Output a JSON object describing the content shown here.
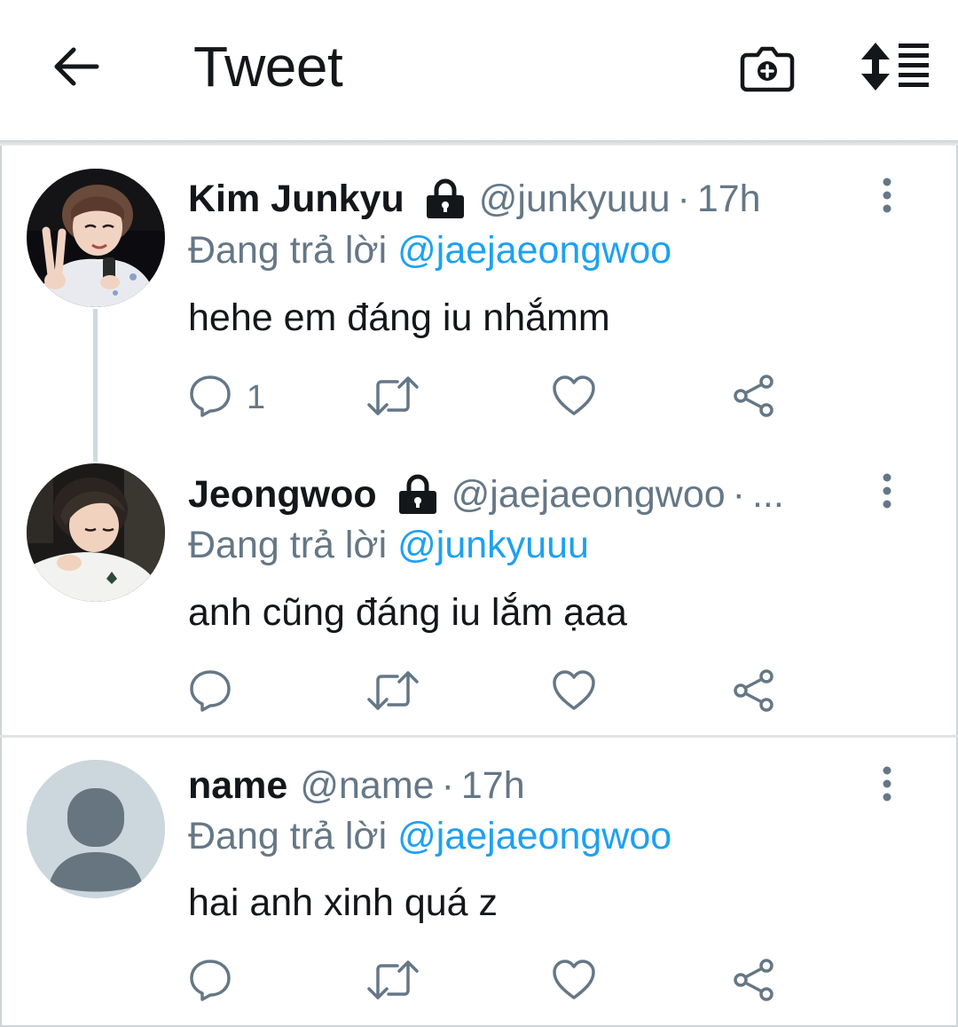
{
  "header": {
    "title": "Tweet",
    "back_icon": "arrow-left-icon",
    "camera_icon": "camera-add-icon",
    "sort_icon": "sort-list-icon"
  },
  "tweets": [
    {
      "name": "Kim Junkyu",
      "protected": true,
      "handle": "@junkyuuu",
      "separator": "·",
      "time": "17h",
      "reply_prefix": "Đang trả lời",
      "reply_to": "@jaejaeongwoo",
      "text": "hehe em đáng iu nhắmm",
      "reply_count": "1"
    },
    {
      "name": "Jeongwoo",
      "protected": true,
      "handle": "@jaejaeongwoo",
      "separator": "·",
      "time": "...",
      "reply_prefix": "Đang trả lời",
      "reply_to": "@junkyuuu",
      "text": "anh cũng đáng iu lắm ạaa",
      "reply_count": ""
    },
    {
      "name": "name",
      "protected": false,
      "handle": "@name",
      "separator": "·",
      "time": "17h",
      "reply_prefix": "Đang trả lời",
      "reply_to": "@jaejaeongwoo",
      "text": "hai anh xinh quá z",
      "reply_count": ""
    }
  ],
  "colors": {
    "text": "#14171a",
    "secondary": "#657786",
    "link": "#1da1f2",
    "default_avatar_bg": "#ccd6dd",
    "default_avatar_fg": "#66757f"
  }
}
